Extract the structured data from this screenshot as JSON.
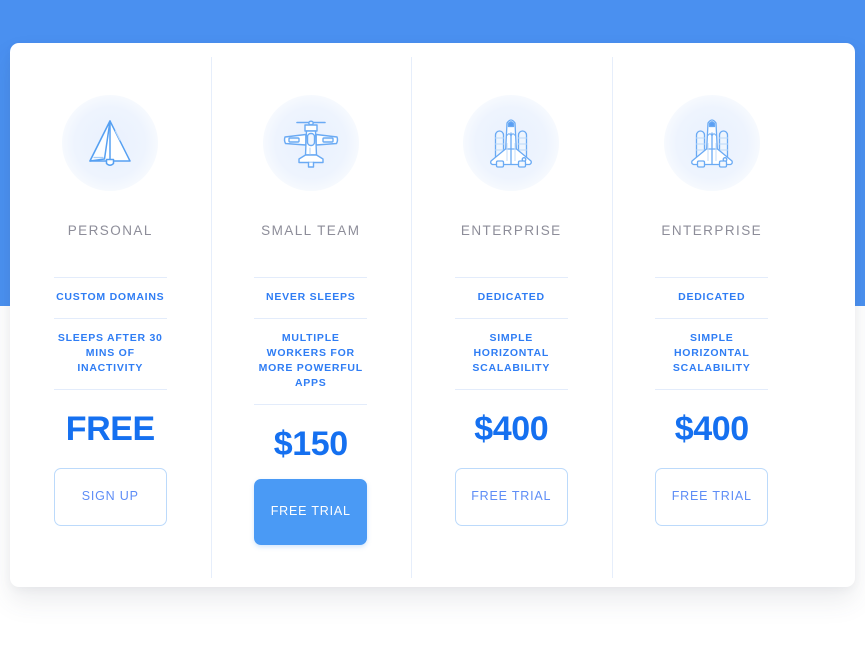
{
  "theme": {
    "band_color": "#4a90f0",
    "panel_color": "#ffffff",
    "accent_blue": "#2f7df4",
    "price_blue": "#1570f0",
    "button_fill": "#4a9af5",
    "title_gray": "#8d8d99",
    "divider_blue": "#e3ecfb"
  },
  "plans": [
    {
      "id": "personal",
      "icon": "paper-plane-icon",
      "title": "PERSONAL",
      "features": [
        "CUSTOM DOMAINS",
        "SLEEPS AFTER 30 MINS OF INACTIVITY"
      ],
      "price": "FREE",
      "cta_label": "SIGN UP",
      "cta_style": "outline"
    },
    {
      "id": "small-team",
      "icon": "propeller-plane-icon",
      "title": "SMALL TEAM",
      "features": [
        "NEVER SLEEPS",
        "MULTIPLE WORKERS FOR MORE POWERFUL APPS"
      ],
      "price": "$150",
      "cta_label": "FREE TRIAL",
      "cta_style": "filled"
    },
    {
      "id": "enterprise-1",
      "icon": "space-shuttle-icon",
      "title": "ENTERPRISE",
      "features": [
        "DEDICATED",
        "SIMPLE HORIZONTAL SCALABILITY"
      ],
      "price": "$400",
      "cta_label": "FREE TRIAL",
      "cta_style": "outline"
    },
    {
      "id": "enterprise-2",
      "icon": "space-shuttle-icon",
      "title": "ENTERPRISE",
      "features": [
        "DEDICATED",
        "SIMPLE HORIZONTAL SCALABILITY"
      ],
      "price": "$400",
      "cta_label": "FREE TRIAL",
      "cta_style": "outline"
    }
  ]
}
